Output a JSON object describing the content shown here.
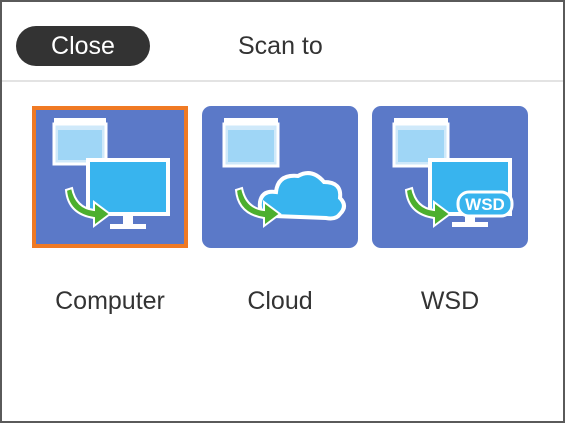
{
  "header": {
    "close_label": "Close",
    "title": "Scan to"
  },
  "destinations": [
    {
      "label": "Computer",
      "icon": "computer-icon",
      "selected": true
    },
    {
      "label": "Cloud",
      "icon": "cloud-icon",
      "selected": false
    },
    {
      "label": "WSD",
      "icon": "wsd-icon",
      "icon_text": "WSD",
      "selected": false
    }
  ],
  "colors": {
    "tile": "#5b79c8",
    "selection_border": "#f07a24",
    "close_button": "#333333",
    "monitor": "#38b4ee",
    "arrow": "#4caf2e"
  }
}
